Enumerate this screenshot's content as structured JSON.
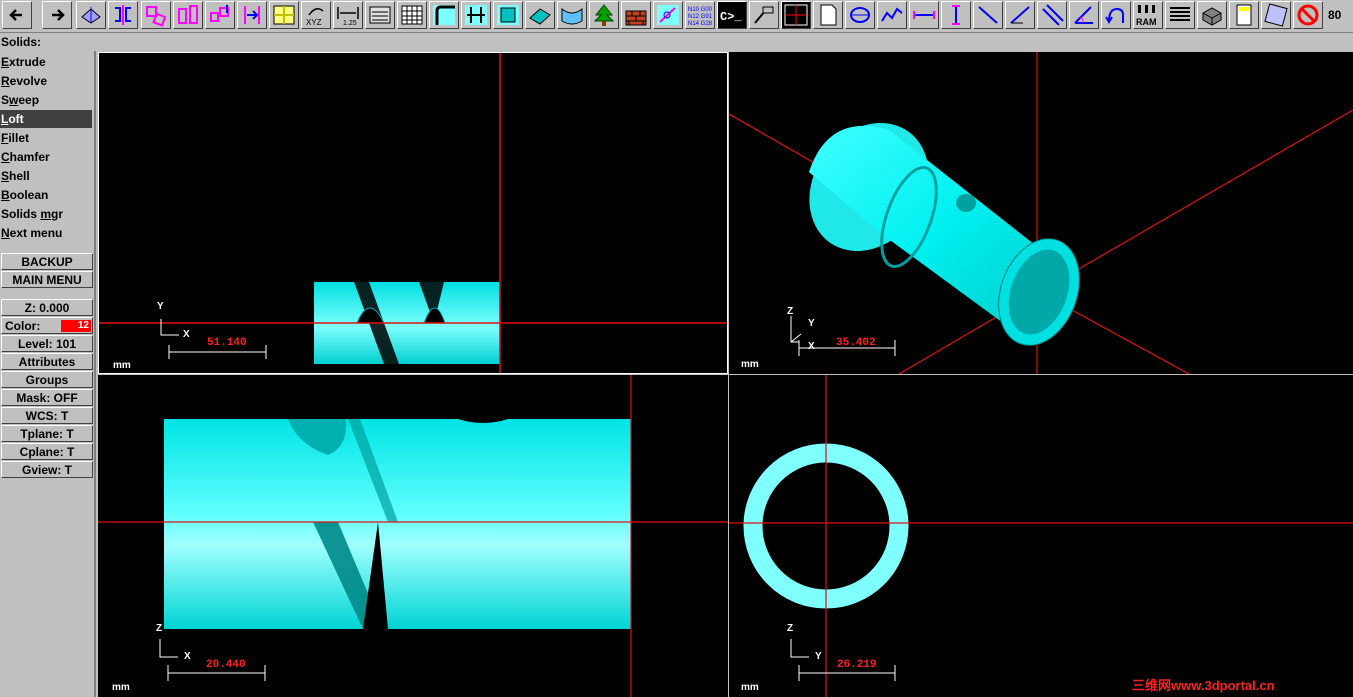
{
  "toolbar": {
    "buttons": [
      "left-arrow-icon",
      "right-arrow-icon",
      "gview-icon",
      "mirror-icon",
      "translate-icon",
      "rotate-icon",
      "scale-icon",
      "break-icon",
      "tplane-icon",
      "xyz-icon",
      "dim-icon",
      "file-icon",
      "grid-icon",
      "fillet-icon",
      "trim-icon",
      "surface-icon",
      "surface-flat-icon",
      "surface-loft-icon",
      "tree-icon",
      "wall-icon",
      "analyze-icon",
      "nc-code-icon",
      "command-icon",
      "plot-icon",
      "windows-icon",
      "new-icon",
      "circle-icon",
      "spline-icon",
      "horizontal-line-icon",
      "vertical-line-icon",
      "diagonal-line-icon",
      "angle-line-icon",
      "parallel-line-icon",
      "polar-icon",
      "undo-icon",
      "ram-icon",
      "print-icon",
      "solid-box-icon",
      "calculator-icon",
      "erase-icon",
      "no-icon"
    ],
    "nc_text": "N10 G00\nN12 G91\nN14 G28",
    "cmd_text": "C>_",
    "ram_text": "RAM",
    "dim_text": "1.25",
    "xyz_text": "XYZ",
    "count": "80"
  },
  "prompt": "Solids:",
  "menu": {
    "items": [
      {
        "pre": "",
        "key": "E",
        "rest": "xtrude"
      },
      {
        "pre": "",
        "key": "R",
        "rest": "evolve"
      },
      {
        "pre": "S",
        "key": "w",
        "rest": "eep"
      },
      {
        "pre": "",
        "key": "L",
        "rest": "oft"
      },
      {
        "pre": "",
        "key": "F",
        "rest": "illet"
      },
      {
        "pre": "",
        "key": "C",
        "rest": "hamfer"
      },
      {
        "pre": "",
        "key": "S",
        "rest": "hell"
      },
      {
        "pre": "",
        "key": "B",
        "rest": "oolean"
      },
      {
        "pre": "Solids ",
        "key": "m",
        "rest": "gr"
      },
      {
        "pre": "",
        "key": "N",
        "rest": "ext menu"
      }
    ],
    "selected_index": 3,
    "backup": "BACKUP",
    "main_menu": "MAIN MENU",
    "z": "Z:  0.000",
    "color_label": "Color:",
    "color_value": "12",
    "level": "Level: 101",
    "attributes": "Attributes",
    "groups": "Groups",
    "mask": "Mask:  OFF",
    "wcs": "WCS:   T",
    "tplane": "Tplane:  T",
    "cplane": "Cplane:  T",
    "gview": "Gview:   T"
  },
  "viewports": {
    "top_left": {
      "axis_v": "Y",
      "axis_h": "X",
      "scale": "51.140",
      "unit": "mm"
    },
    "top_right": {
      "axis_v": "Z",
      "axis_h": "X",
      "axis_d": "Y",
      "scale": "35.402",
      "unit": "mm"
    },
    "bottom_left": {
      "axis_v": "Z",
      "axis_h": "X",
      "scale": "20.440",
      "unit": "mm"
    },
    "bottom_right": {
      "axis_v": "Z",
      "axis_h": "Y",
      "scale": "26.219",
      "unit": "mm"
    }
  },
  "watermark": "三维网www.3dportal.cn",
  "colors": {
    "solid": "#00ffff",
    "crosshair": "#e01010",
    "background": "#000000"
  }
}
